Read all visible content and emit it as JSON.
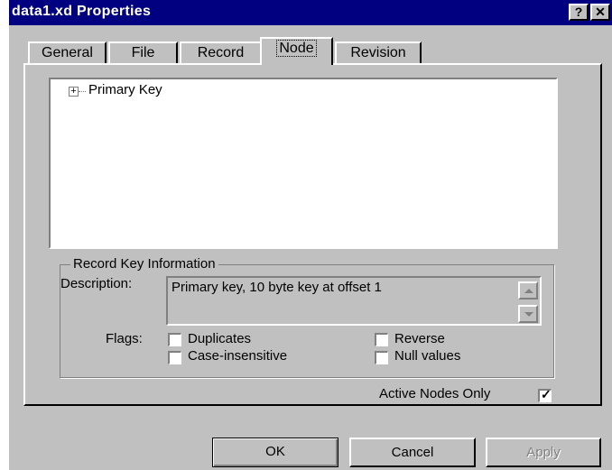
{
  "window": {
    "title": "data1.xd Properties",
    "help_glyph": "?",
    "close_glyph": "✕"
  },
  "tabs": [
    "General",
    "File",
    "Record",
    "Node",
    "Revision"
  ],
  "active_tab": "Node",
  "tree": {
    "expander": "+",
    "items": [
      "Primary Key"
    ]
  },
  "record_key": {
    "group_label": "Record Key Information",
    "description_label": "Description:",
    "description_value": "Primary key, 10 byte key at offset 1",
    "flags_label": "Flags:",
    "flags": [
      {
        "label": "Duplicates",
        "checked": false
      },
      {
        "label": "Reverse",
        "checked": false
      },
      {
        "label": "Case-insensitive",
        "checked": false
      },
      {
        "label": "Null values",
        "checked": false
      }
    ]
  },
  "active_nodes": {
    "label": "Active Nodes Only",
    "checked": true,
    "mark": "✓"
  },
  "buttons": {
    "ok": "OK",
    "cancel": "Cancel",
    "apply": "Apply"
  }
}
